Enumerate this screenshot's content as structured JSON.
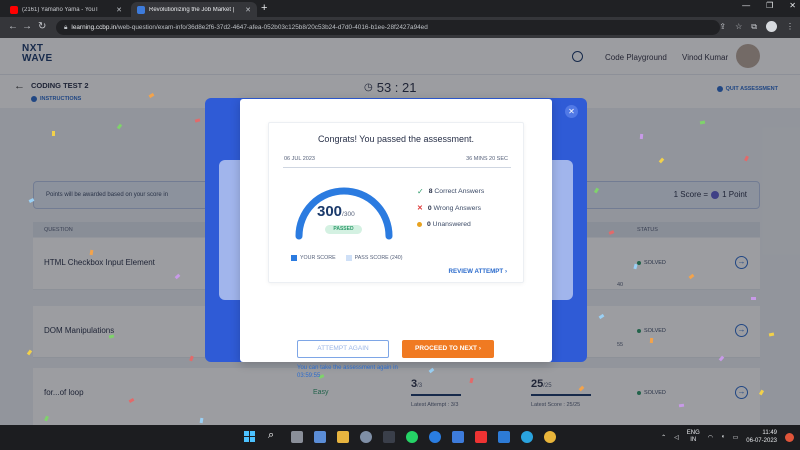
{
  "browser": {
    "tabs": [
      {
        "title": "(2161) Yamaho Yama - YouT",
        "favicon_color": "#ff0000"
      },
      {
        "title": "Revolutionizing the Job Market |",
        "favicon_color": "#3d7bdb"
      }
    ],
    "url_host": "learning.ccbp.in",
    "url_path": "/web-question/exam-info/36d8e2f6-37d2-4647-afea-052b03c125b8/20c53b24-d7d0-4016-b1ee-28f2427a94ed"
  },
  "app": {
    "logo_line1": "NXT",
    "logo_line2": "WAVE",
    "code_playground": "Code Playground",
    "user_name": "Vinod Kumar",
    "test_title": "CODING TEST 2",
    "instructions_label": "INSTRUCTIONS",
    "timer": "53 : 21",
    "quit_label": "QUIT ASSESSMENT",
    "points_note": "Points will be awarded based on your score in",
    "score_point": "1 Score =",
    "score_point_value": "1 Point"
  },
  "table": {
    "headers": {
      "question": "QUESTION",
      "status": "STATUS"
    },
    "rows": [
      {
        "question": "HTML Checkbox Input Element",
        "difficulty": "",
        "attempts": "",
        "attempts_total": "",
        "attempts_label": "",
        "score": "",
        "score_total": "",
        "score_label": "",
        "status": "SOLVED"
      },
      {
        "question": "DOM Manipulations",
        "difficulty": "",
        "attempts": "",
        "attempts_total": "",
        "attempts_label": "",
        "score": "",
        "score_total": "",
        "score_label": "",
        "status": "SOLVED"
      },
      {
        "question": "for...of loop",
        "difficulty": "Easy",
        "attempts": "3",
        "attempts_total": "/3",
        "attempts_label": "Latest Attempt : 3/3",
        "score": "25",
        "score_total": "/25",
        "score_label": "Latest Score : 25/25",
        "status": "SOLVED"
      }
    ],
    "partial_labels": [
      "40",
      "55"
    ]
  },
  "modal": {
    "title": "Congrats! You passed the assessment.",
    "date": "06 JUL 2023",
    "duration": "36 MINS 20 SEC",
    "score": "300",
    "score_total": "/300",
    "score_fraction": 1.0,
    "status_badge": "PASSED",
    "correct_count": "8",
    "correct_label": "Correct Answers",
    "wrong_count": "0",
    "wrong_label": "Wrong Answers",
    "unanswered_count": "0",
    "unanswered_label": "Unanswered",
    "legend_your_score": "YOUR SCORE",
    "legend_pass_score": "PASS SCORE (240)",
    "review_label": "REVIEW ATTEMPT",
    "attempt_again_label": "ATTEMPT AGAIN",
    "proceed_label": "PROCEED TO NEXT",
    "attempt_note": "You can take the assessment again in 03:59:55"
  },
  "taskbar": {
    "lang1": "ENG",
    "lang2": "IN",
    "time": "11:49",
    "date": "06-07-2023"
  },
  "colors": {
    "accent_blue": "#2b6bcc",
    "gauge_blue": "#2b7be0",
    "proceed_orange": "#f07a22",
    "passed_green": "#2e9b6b"
  }
}
